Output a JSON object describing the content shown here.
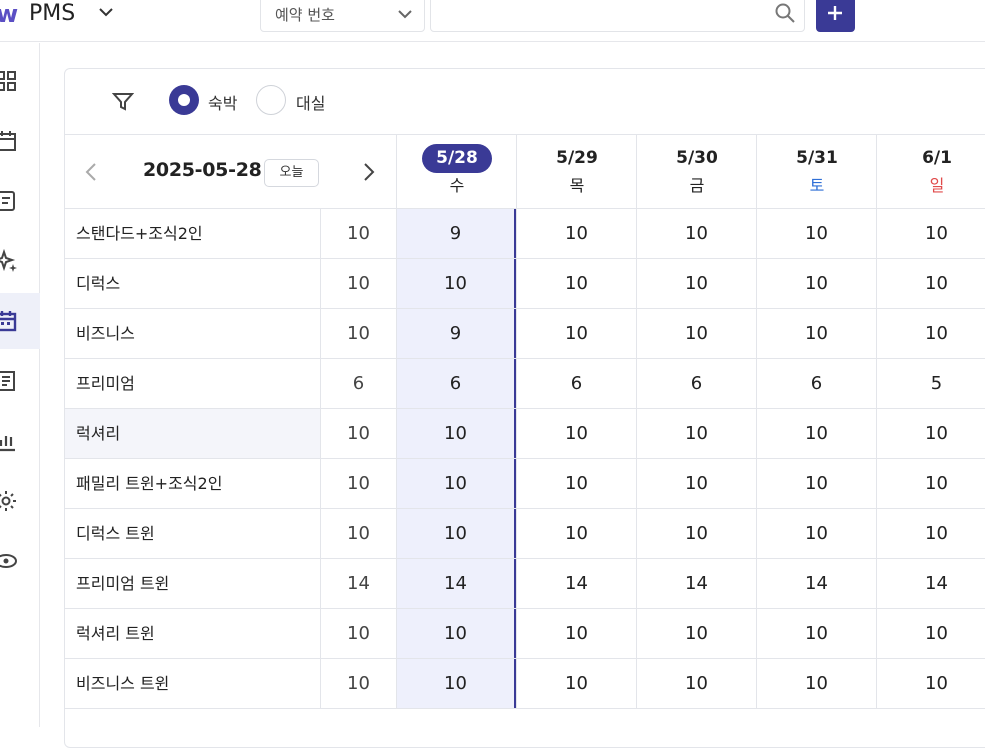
{
  "header": {
    "app_title": "PMS",
    "search_type": "예약 번호",
    "search_value": ""
  },
  "sidebar": {
    "items": [
      {
        "icon": "grid-icon"
      },
      {
        "icon": "calendar-icon"
      },
      {
        "icon": "receipt-icon"
      },
      {
        "icon": "sparkle-icon"
      },
      {
        "icon": "calendar-grid-icon",
        "active": true
      },
      {
        "icon": "document-icon"
      },
      {
        "icon": "bar-chart-icon"
      },
      {
        "icon": "gear-icon"
      },
      {
        "icon": "eye-icon"
      }
    ]
  },
  "filters": {
    "stay_label": "숙박",
    "dayuse_label": "대실",
    "selected": "숙박"
  },
  "calendar": {
    "current_date": "2025-05-28",
    "today_label": "오늘",
    "days": [
      {
        "date": "5/28",
        "weekday": "수",
        "weekday_color": "#222222",
        "selected": true
      },
      {
        "date": "5/29",
        "weekday": "목",
        "weekday_color": "#222222"
      },
      {
        "date": "5/30",
        "weekday": "금",
        "weekday_color": "#222222"
      },
      {
        "date": "5/31",
        "weekday": "토",
        "weekday_color": "#2f6fd6"
      },
      {
        "date": "6/1",
        "weekday": "일",
        "weekday_color": "#e04b4b"
      }
    ]
  },
  "rooms": [
    {
      "name": "스탠다드+조식2인",
      "total": "10",
      "values": [
        "9",
        "10",
        "10",
        "10",
        "10"
      ]
    },
    {
      "name": "디럭스",
      "total": "10",
      "values": [
        "10",
        "10",
        "10",
        "10",
        "10"
      ]
    },
    {
      "name": "비즈니스",
      "total": "10",
      "values": [
        "9",
        "10",
        "10",
        "10",
        "10"
      ]
    },
    {
      "name": "프리미엄",
      "total": "6",
      "values": [
        "6",
        "6",
        "6",
        "6",
        "5"
      ]
    },
    {
      "name": "럭셔리",
      "total": "10",
      "values": [
        "10",
        "10",
        "10",
        "10",
        "10"
      ],
      "highlight": true
    },
    {
      "name": "패밀리 트윈+조식2인",
      "total": "10",
      "values": [
        "10",
        "10",
        "10",
        "10",
        "10"
      ]
    },
    {
      "name": "디럭스 트윈",
      "total": "10",
      "values": [
        "10",
        "10",
        "10",
        "10",
        "10"
      ]
    },
    {
      "name": "프리미엄 트윈",
      "total": "14",
      "values": [
        "14",
        "14",
        "14",
        "14",
        "14"
      ]
    },
    {
      "name": "럭셔리 트윈",
      "total": "10",
      "values": [
        "10",
        "10",
        "10",
        "10",
        "10"
      ]
    },
    {
      "name": "비즈니스 트윈",
      "total": "10",
      "values": [
        "10",
        "10",
        "10",
        "10",
        "10"
      ]
    }
  ],
  "colors": {
    "accent": "#3a3a96",
    "selected_column_bg": "#eef0fc",
    "saturday": "#2f6fd6",
    "sunday": "#e04b4b"
  }
}
